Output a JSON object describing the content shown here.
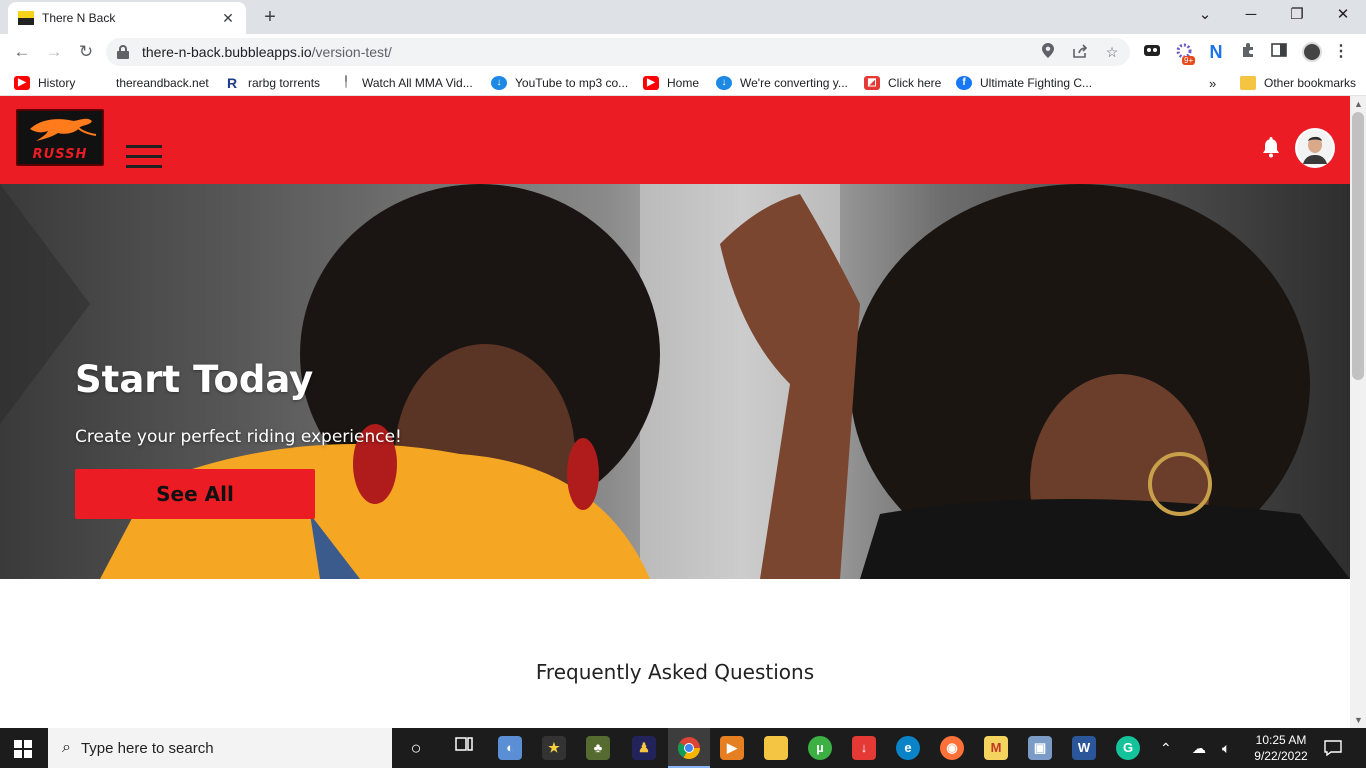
{
  "browser": {
    "tab": {
      "title": "There N Back",
      "close": "✕"
    },
    "new_tab": "+",
    "window_controls": {
      "minimize": "─",
      "restore": "❐",
      "close": "✕",
      "dropdown": "⌄"
    },
    "nav": {
      "back": "←",
      "forward": "→",
      "reload": "↻"
    },
    "url": {
      "host": "there-n-back.bubbleapps.io",
      "path": "/version-test/"
    },
    "omnibox_icons": [
      "location-icon",
      "share-icon",
      "star-icon"
    ],
    "extension_badge": "9+",
    "bookmarks": [
      {
        "label": "History",
        "icon": "youtube-icon",
        "color": "#ff0000"
      },
      {
        "label": "thereandback.net",
        "icon": "none",
        "color": ""
      },
      {
        "label": "rarbg torrents",
        "icon": "r-icon",
        "color": "#1e3a8a"
      },
      {
        "label": "Watch All MMA Vid...",
        "icon": "mma-icon",
        "color": "#888888"
      },
      {
        "label": "YouTube to mp3 co...",
        "icon": "download-icon",
        "color": "#1e88e5"
      },
      {
        "label": "Home",
        "icon": "youtube-icon",
        "color": "#ff0000"
      },
      {
        "label": "We're converting y...",
        "icon": "download-icon",
        "color": "#1e88e5"
      },
      {
        "label": "Click here",
        "icon": "pdf-icon",
        "color": "#e53935"
      },
      {
        "label": "Ultimate Fighting C...",
        "icon": "facebook-icon",
        "color": "#1877f2"
      }
    ],
    "bookmarks_overflow": "»",
    "other_bookmarks": "Other bookmarks"
  },
  "app": {
    "logo_text": "RUSSH",
    "hero": {
      "title": "Start Today",
      "subtitle": "Create your perfect riding experience!",
      "button": "See All"
    },
    "faq_heading": "Frequently Asked Questions",
    "brand_color": "#ec1c24"
  },
  "taskbar": {
    "search_placeholder": "Type here to search",
    "time": "10:25 AM",
    "date": "9/22/2022"
  }
}
